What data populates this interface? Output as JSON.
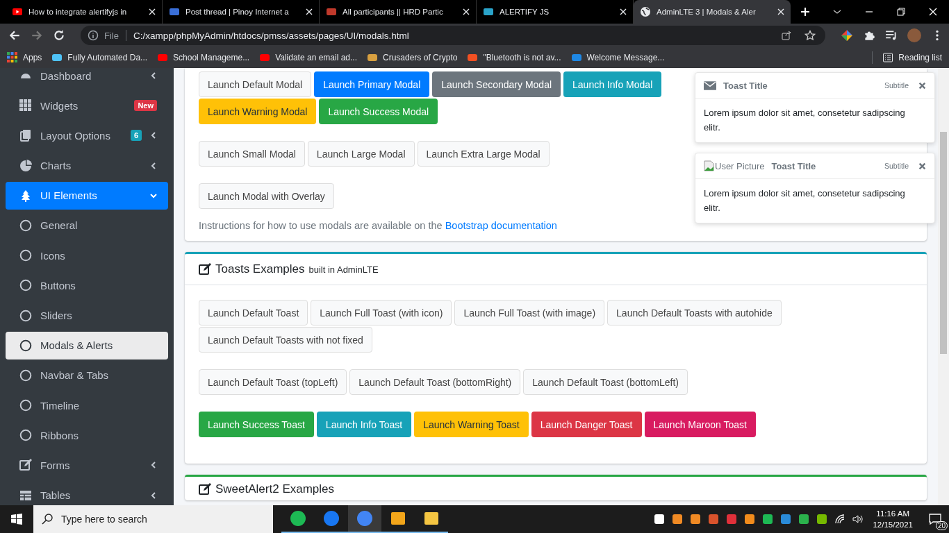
{
  "browser": {
    "tabs": [
      {
        "title": "How to integrate alertifyjs in",
        "selected": false
      },
      {
        "title": "Post thread | Pinoy Internet a",
        "selected": false
      },
      {
        "title": "All participants || HRD Partic",
        "selected": false
      },
      {
        "title": "ALERTIFY JS",
        "selected": false
      },
      {
        "title": "AdminLTE 3 | Modals & Aler",
        "selected": true
      }
    ],
    "address": {
      "scheme": "File",
      "url": "C:/xampp/phpMyAdmin/htdocs/pmss/assets/pages/UI/modals.html"
    },
    "apps_label": "Apps",
    "bookmarks": [
      "Fully Automated Da...",
      "School Manageme...",
      "Validate an email ad...",
      "Crusaders of Crypto",
      "\"Bluetooth is not av...",
      "Welcome Message..."
    ],
    "reading_list": "Reading list"
  },
  "sidebar": {
    "items": [
      {
        "label": "Dashboard",
        "selected": false,
        "expanded": false
      },
      {
        "label": "Widgets",
        "selected": false,
        "badge": {
          "text": "New",
          "color": "#dc3545"
        }
      },
      {
        "label": "Layout Options",
        "selected": false,
        "expanded": false,
        "badge": {
          "text": "6",
          "color": "#17a2b8"
        }
      },
      {
        "label": "Charts",
        "selected": false,
        "expanded": false
      },
      {
        "label": "UI Elements",
        "selected": true,
        "expanded": true,
        "children": [
          {
            "label": "General",
            "selected": false
          },
          {
            "label": "Icons",
            "selected": false
          },
          {
            "label": "Buttons",
            "selected": false
          },
          {
            "label": "Sliders",
            "selected": false
          },
          {
            "label": "Modals & Alerts",
            "selected": true
          },
          {
            "label": "Navbar & Tabs",
            "selected": false
          },
          {
            "label": "Timeline",
            "selected": false
          },
          {
            "label": "Ribbons",
            "selected": false
          }
        ]
      },
      {
        "label": "Forms",
        "selected": false,
        "expanded": false
      },
      {
        "label": "Tables",
        "selected": false,
        "expanded": false
      }
    ]
  },
  "modals_card": {
    "groups": [
      {
        "rows": [
          [
            {
              "label": "Launch Default Modal",
              "kind": "default"
            },
            {
              "label": "Launch Primary Modal",
              "kind": "primary"
            },
            {
              "label": "Launch Secondary Modal",
              "kind": "secondary"
            },
            {
              "label": "Launch Info Modal",
              "kind": "info"
            }
          ],
          [
            {
              "label": "Launch Warning Modal",
              "kind": "warning"
            },
            {
              "label": "Launch Success Modal",
              "kind": "success"
            }
          ]
        ]
      },
      {
        "rows": [
          [
            {
              "label": "Launch Small Modal",
              "kind": "default"
            },
            {
              "label": "Launch Large Modal",
              "kind": "default"
            },
            {
              "label": "Launch Extra Large Modal",
              "kind": "default"
            }
          ]
        ]
      },
      {
        "rows": [
          [
            {
              "label": "Launch Modal with Overlay",
              "kind": "default"
            }
          ]
        ]
      }
    ],
    "instructions": {
      "text": "Instructions for how to use modals are available on the",
      "link": "Bootstrap documentation"
    }
  },
  "toasts_card": {
    "title": "Toasts Examples",
    "subtitle": "built in AdminLTE",
    "groups": [
      {
        "rows": [
          [
            {
              "label": "Launch Default Toast",
              "kind": "default"
            },
            {
              "label": "Launch Full Toast (with icon)",
              "kind": "default"
            },
            {
              "label": "Launch Full Toast (with image)",
              "kind": "default"
            },
            {
              "label": "Launch Default Toasts with autohide",
              "kind": "default"
            }
          ],
          [
            {
              "label": "Launch Default Toasts with not fixed",
              "kind": "default"
            }
          ]
        ]
      },
      {
        "rows": [
          [
            {
              "label": "Launch Default Toast (topLeft)",
              "kind": "default"
            },
            {
              "label": "Launch Default Toast (bottomRight)",
              "kind": "default"
            },
            {
              "label": "Launch Default Toast (bottomLeft)",
              "kind": "default"
            }
          ]
        ]
      },
      {
        "rows": [
          [
            {
              "label": "Launch Success Toast",
              "kind": "success"
            },
            {
              "label": "Launch Info Toast",
              "kind": "info"
            },
            {
              "label": "Launch Warning Toast",
              "kind": "warning"
            },
            {
              "label": "Launch Danger Toast",
              "kind": "danger"
            },
            {
              "label": "Launch Maroon Toast",
              "kind": "maroon"
            }
          ]
        ]
      }
    ]
  },
  "sweetalert_card": {
    "title": "SweetAlert2 Examples"
  },
  "toasts": [
    {
      "kind": "icon",
      "title": "Toast Title",
      "subtitle": "Subtitle",
      "body": "Lorem ipsum dolor sit amet, consetetur sadipscing elitr."
    },
    {
      "kind": "image",
      "image_alt": "User Picture",
      "title": "Toast Title",
      "subtitle": "Subtitle",
      "body": "Lorem ipsum dolor sit amet, consetetur sadipscing elitr."
    }
  ],
  "taskbar": {
    "search_placeholder": "Type here to search",
    "apps": [
      {
        "selected": false
      },
      {
        "selected": false
      },
      {
        "selected": true
      },
      {
        "selected": false
      },
      {
        "selected": false
      }
    ],
    "time": "11:16 AM",
    "date": "12/15/2021",
    "notifications": "20"
  }
}
